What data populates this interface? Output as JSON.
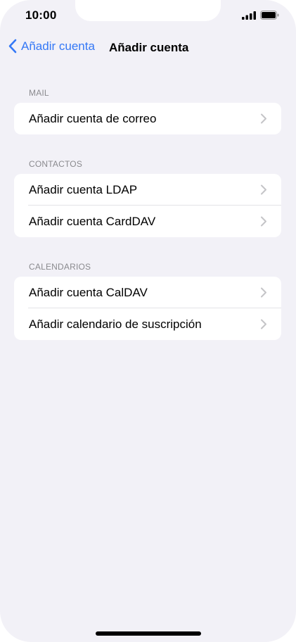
{
  "status_bar": {
    "time": "10:00"
  },
  "nav": {
    "back_label": "Añadir cuenta",
    "title": "Añadir cuenta"
  },
  "sections": [
    {
      "header": "MAIL",
      "items": [
        {
          "label": "Añadir cuenta de correo"
        }
      ]
    },
    {
      "header": "CONTACTOS",
      "items": [
        {
          "label": "Añadir cuenta LDAP"
        },
        {
          "label": "Añadir cuenta CardDAV"
        }
      ]
    },
    {
      "header": "CALENDARIOS",
      "items": [
        {
          "label": "Añadir cuenta CalDAV"
        },
        {
          "label": "Añadir calendario de suscripción"
        }
      ]
    }
  ],
  "colors": {
    "accent": "#3478f6",
    "background": "#f2f1f7",
    "section_header": "#8a8a8e"
  },
  "icons": {
    "back": "chevron-left-icon",
    "row": "chevron-right-icon",
    "signal": "cellular-signal-icon",
    "battery": "battery-icon"
  }
}
